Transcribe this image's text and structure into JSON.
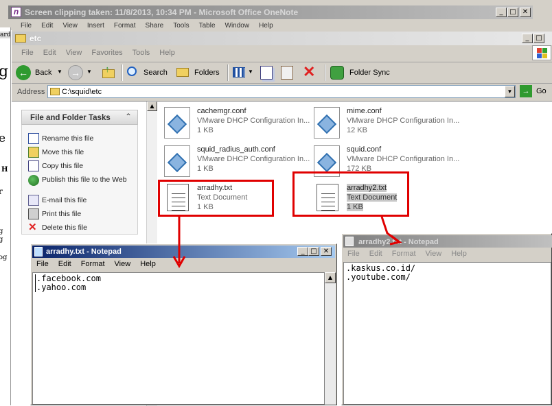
{
  "onenote": {
    "title": "Screen clipping taken: 11/8/2013, 10:34 PM - Microsoft Office OneNote",
    "menu": [
      "File",
      "Edit",
      "View",
      "Insert",
      "Format",
      "Share",
      "Tools",
      "Table",
      "Window",
      "Help"
    ],
    "side_letters": [
      "ard",
      "g",
      "e",
      "H",
      "r",
      "g",
      "g",
      "og"
    ]
  },
  "explorer": {
    "title": "etc",
    "menu": [
      "File",
      "Edit",
      "View",
      "Favorites",
      "Tools",
      "Help"
    ],
    "toolbar": {
      "back": "Back",
      "search": "Search",
      "folders": "Folders",
      "folder_sync": "Folder Sync"
    },
    "address_label": "Address",
    "address_value": "C:\\squid\\etc",
    "go_label": "Go",
    "tasks_title": "File and Folder Tasks",
    "tasks": [
      "Rename this file",
      "Move this file",
      "Copy this file",
      "Publish this file to the Web",
      "E-mail this file",
      "Print this file",
      "Delete this file"
    ],
    "files": [
      {
        "name": "cachemgr.conf",
        "type": "VMware DHCP Configuration In...",
        "size": "1 KB",
        "icon": "config-icon"
      },
      {
        "name": "mime.conf",
        "type": "VMware DHCP Configuration In...",
        "size": "12 KB",
        "icon": "config-icon"
      },
      {
        "name": "squid_radius_auth.conf",
        "type": "VMware DHCP Configuration In...",
        "size": "1 KB",
        "icon": "config-icon"
      },
      {
        "name": "squid.conf",
        "type": "VMware DHCP Configuration In...",
        "size": "172 KB",
        "icon": "config-icon"
      },
      {
        "name": "arradhy.txt",
        "type": "Text Document",
        "size": "1 KB",
        "icon": "notepad-file-icon"
      },
      {
        "name": "arradhy2.txt",
        "type": "Text Document",
        "size": "1 KB",
        "icon": "notepad-file-icon"
      }
    ]
  },
  "notepad1": {
    "title": "arradhy.txt - Notepad",
    "menu": [
      "File",
      "Edit",
      "Format",
      "View",
      "Help"
    ],
    "content": ".facebook.com\n.yahoo.com"
  },
  "notepad2": {
    "title": "arradhy2.txt - Notepad",
    "menu": [
      "File",
      "Edit",
      "Format",
      "View",
      "Help"
    ],
    "content": ".kaskus.co.id/\n.youtube.com/"
  },
  "colors": {
    "xp_blue": "#0a246a",
    "xp_title_grad": "#a6caf0",
    "inactive_title": "#808080",
    "annotation": "#e00000",
    "panel_bg": "#d4d0c8"
  }
}
